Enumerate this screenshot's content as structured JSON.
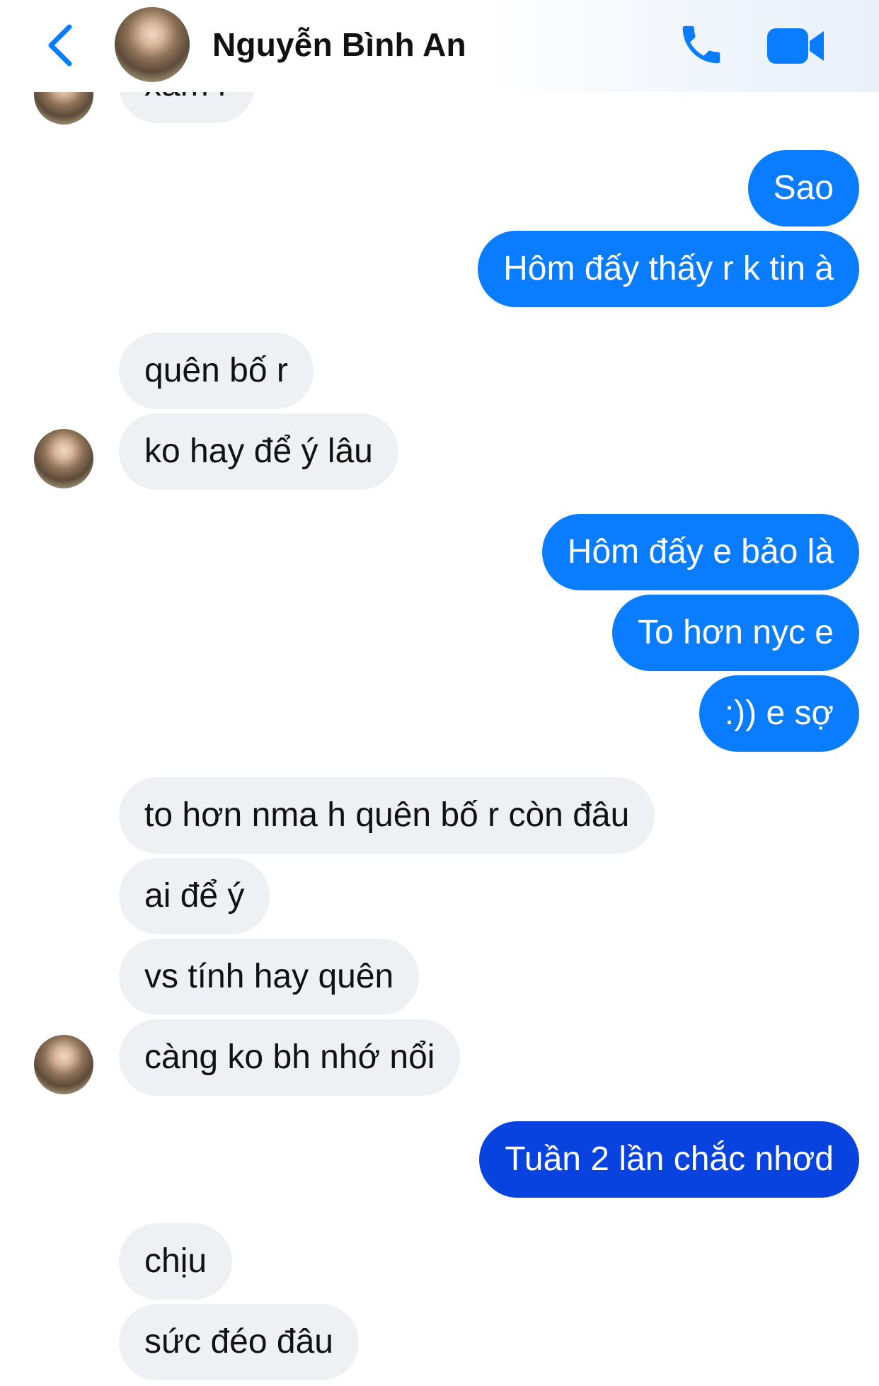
{
  "header": {
    "contact_name": "Nguyễn Bình An"
  },
  "icons": {
    "back": "chevron-left-icon",
    "call": "phone-icon",
    "video": "video-camera-icon"
  },
  "colors": {
    "accent": "#0a7cff",
    "outgoing_dark": "#0843e0",
    "incoming_bubble": "#eef0f3"
  },
  "messages": {
    "m0": "xấm r",
    "m1": "Sao",
    "m2": "Hôm đấy thấy r k tin à",
    "m3": "quên bố r",
    "m4": "ko hay để ý lâu",
    "m5": "Hôm đấy e bảo là",
    "m6": "To hơn nyc e",
    "m7": ":)) e sợ",
    "m8": "to hơn nma h quên bố r còn đâu",
    "m9": "ai để ý",
    "m10": "vs tính hay quên",
    "m11": "càng ko bh nhớ nổi",
    "m12": "Tuần 2 lần chắc nhơd",
    "m13": "chịu",
    "m14": "sức đéo đâu"
  }
}
